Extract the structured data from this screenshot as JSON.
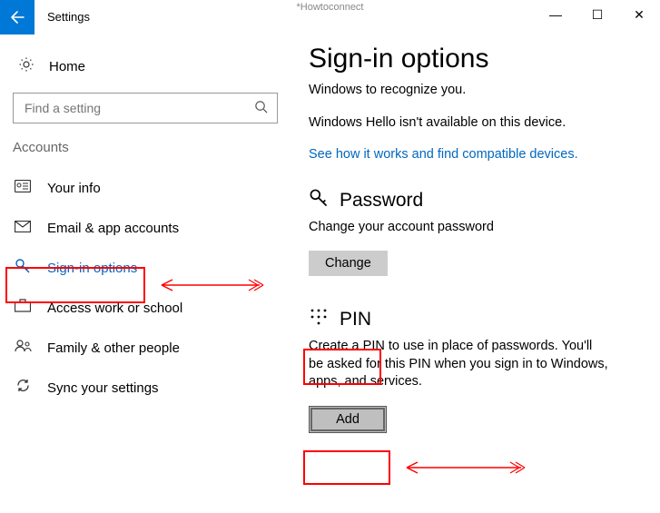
{
  "watermark": "*Howtoconnect",
  "title": "Settings",
  "winctrls": {
    "min": "—",
    "max": "☐",
    "close": "✕"
  },
  "sidebar": {
    "home": "Home",
    "search_placeholder": "Find a setting",
    "group": "Accounts",
    "items": [
      {
        "label": "Your info"
      },
      {
        "label": "Email & app accounts"
      },
      {
        "label": "Sign-in options"
      },
      {
        "label": "Access work or school"
      },
      {
        "label": "Family & other people"
      },
      {
        "label": "Sync your settings"
      }
    ]
  },
  "main": {
    "heading": "Sign-in options",
    "line1": "Windows to recognize you.",
    "line2": "Windows Hello isn't available on this device.",
    "link": "See how it works and find compatible devices.",
    "password": {
      "title": "Password",
      "desc": "Change your account password",
      "button": "Change"
    },
    "pin": {
      "title": "PIN",
      "desc": "Create a PIN to use in place of passwords. You'll be asked for this PIN when you sign in to Windows, apps, and services.",
      "button": "Add"
    }
  }
}
